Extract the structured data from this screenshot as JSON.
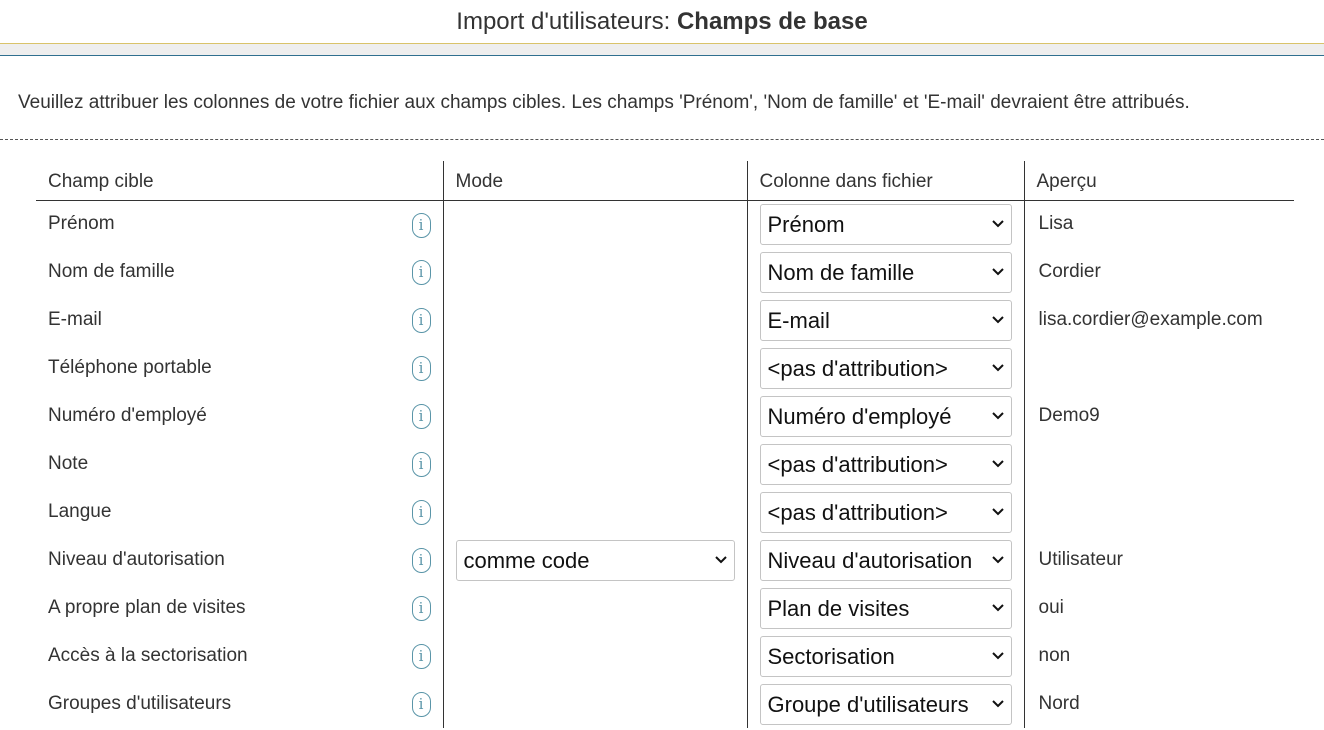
{
  "title": {
    "prefix": "Import d'utilisateurs: ",
    "strong": "Champs de base"
  },
  "instructions": "Veuillez attribuer les colonnes de votre fichier aux champs cibles. Les champs 'Prénom', 'Nom de famille' et 'E-mail' devraient être attribués.",
  "table": {
    "headers": {
      "target": "Champ cible",
      "mode": "Mode",
      "column": "Colonne dans fichier",
      "preview": "Aperçu"
    },
    "info_icon_glyph": "i",
    "rows": [
      {
        "field": "Prénom",
        "mode": "",
        "column": "Prénom",
        "preview": "Lisa"
      },
      {
        "field": "Nom de famille",
        "mode": "",
        "column": "Nom de famille",
        "preview": "Cordier"
      },
      {
        "field": "E-mail",
        "mode": "",
        "column": "E-mail",
        "preview": "lisa.cordier@example.com"
      },
      {
        "field": "Téléphone portable",
        "mode": "",
        "column": "<pas d'attribution>",
        "preview": ""
      },
      {
        "field": "Numéro d'employé",
        "mode": "",
        "column": "Numéro d'employé",
        "preview": "Demo9"
      },
      {
        "field": "Note",
        "mode": "",
        "column": "<pas d'attribution>",
        "preview": ""
      },
      {
        "field": "Langue",
        "mode": "",
        "column": "<pas d'attribution>",
        "preview": ""
      },
      {
        "field": "Niveau d'autorisation",
        "mode": "comme code",
        "column": "Niveau d'autorisation",
        "preview": "Utilisateur"
      },
      {
        "field": "A propre plan de visites",
        "mode": "",
        "column": "Plan de visites",
        "preview": "oui"
      },
      {
        "field": "Accès à la sectorisation",
        "mode": "",
        "column": "Sectorisation",
        "preview": "non"
      },
      {
        "field": "Groupes d'utilisateurs",
        "mode": "",
        "column": "Groupe d'utilisateurs",
        "preview": "Nord"
      }
    ]
  },
  "colors": {
    "accent_border": "#2f6f8f",
    "gold_line": "#d9c36a",
    "info_icon": "#5a95a8"
  }
}
